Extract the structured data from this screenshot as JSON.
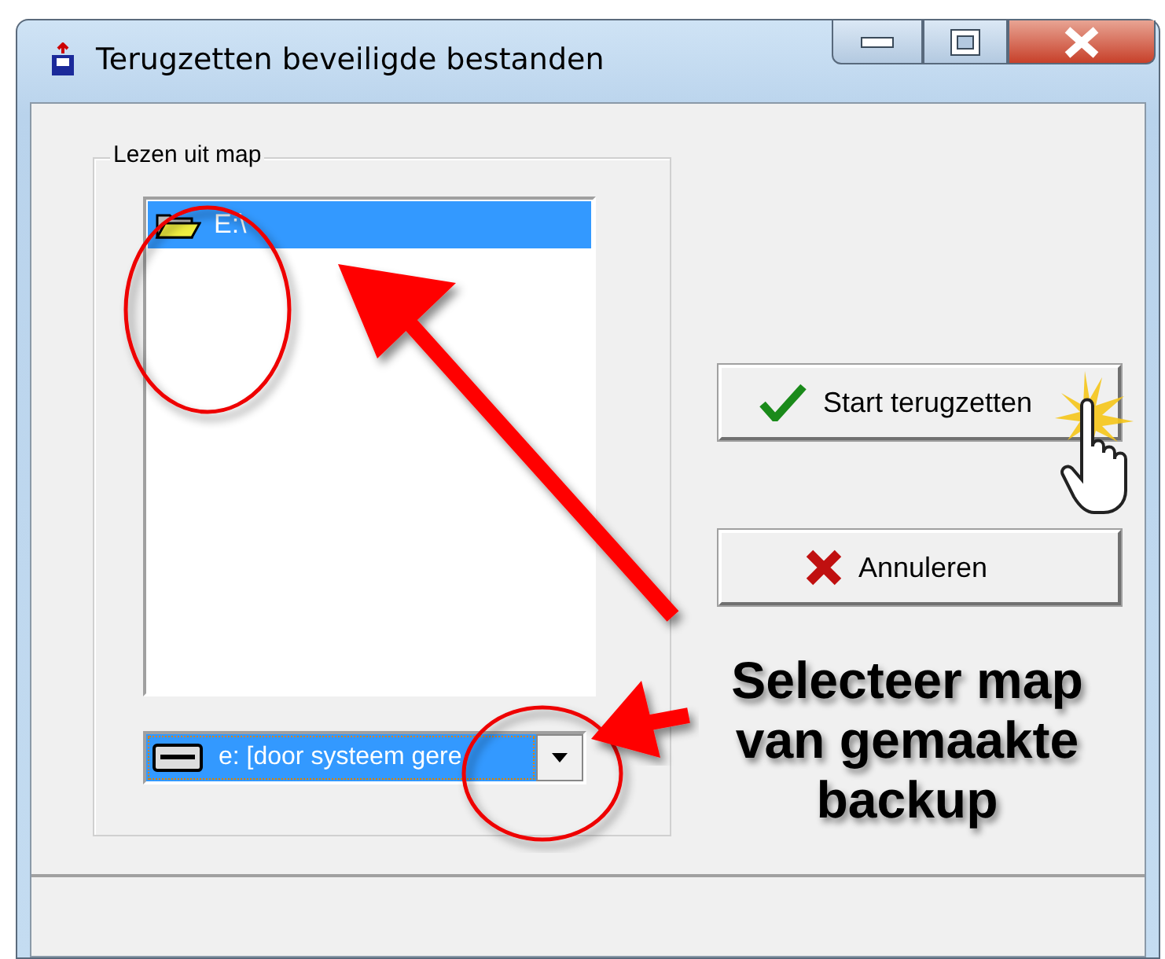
{
  "window": {
    "title": "Terugzetten beveiligde bestanden"
  },
  "group": {
    "label": "Lezen uit map"
  },
  "folders": [
    {
      "label": "E:\\",
      "selected": true
    }
  ],
  "drive": {
    "value": "e: [door systeem gere"
  },
  "buttons": [
    {
      "kind": "confirm",
      "label": "Start terugzetten"
    },
    {
      "kind": "cancel",
      "label": "Annuleren"
    }
  ],
  "annotation": {
    "text": "Selecteer map van gemaakte backup"
  }
}
